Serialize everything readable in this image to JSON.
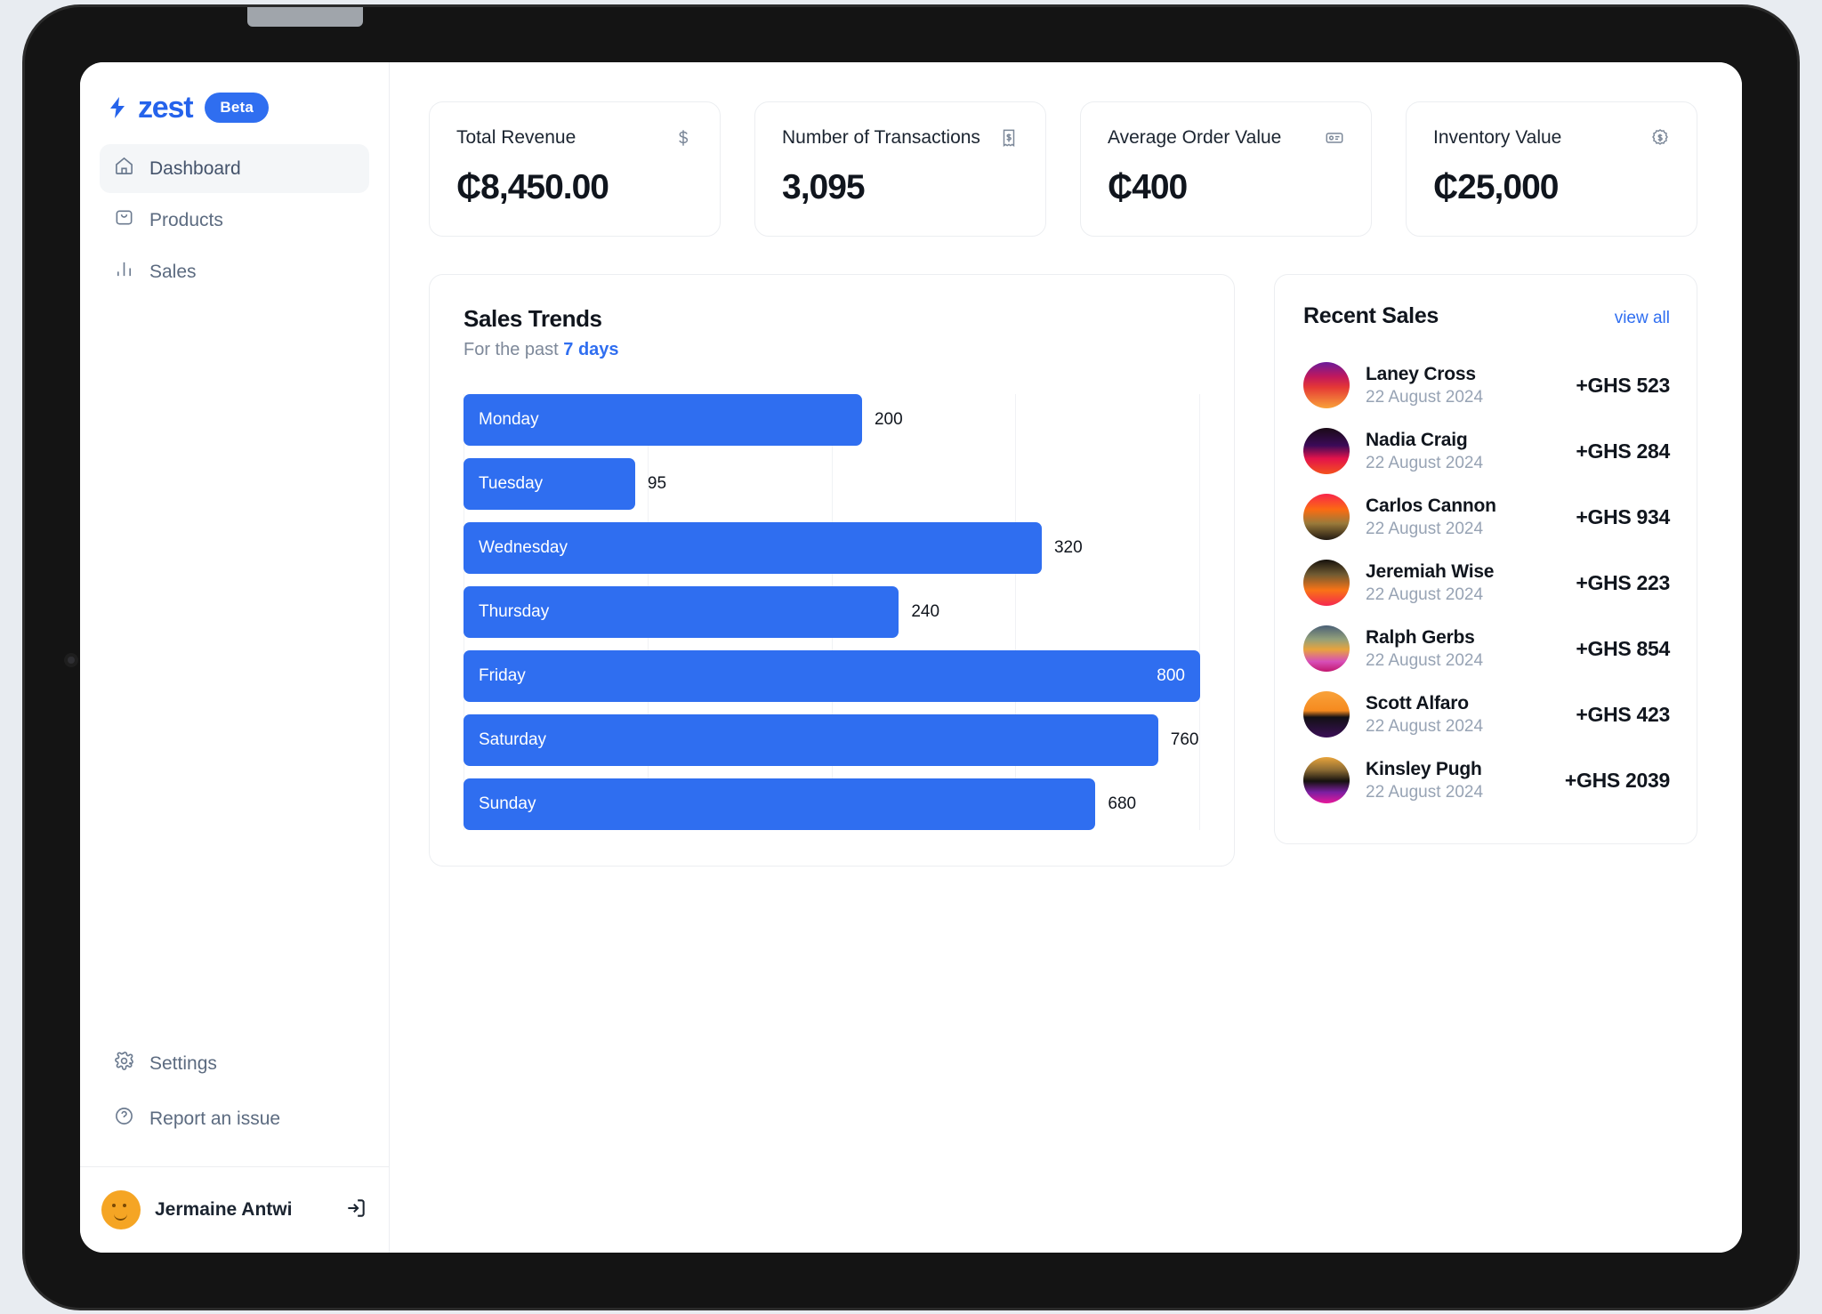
{
  "sidebar": {
    "logo_text": "zest",
    "badge": "Beta",
    "items": [
      {
        "label": "Dashboard",
        "icon": "home-icon",
        "active": true
      },
      {
        "label": "Products",
        "icon": "bag-icon",
        "active": false
      },
      {
        "label": "Sales",
        "icon": "bar-chart-icon",
        "active": false
      }
    ],
    "bottom_items": [
      {
        "label": "Settings",
        "icon": "gear-icon"
      },
      {
        "label": "Report an issue",
        "icon": "question-circle-icon"
      }
    ],
    "user": {
      "name": "Jermaine Antwi",
      "logout_icon": "logout-icon"
    }
  },
  "stats": [
    {
      "label": "Total Revenue",
      "value": "₵8,450.00",
      "icon": "dollar-icon"
    },
    {
      "label": "Number of Transactions",
      "value": "3,095",
      "icon": "receipt-icon"
    },
    {
      "label": "Average Order Value",
      "value": "₵400",
      "icon": "card-icon"
    },
    {
      "label": "Inventory Value",
      "value": "₵25,000",
      "icon": "badge-dollar-icon"
    }
  ],
  "chart_panel": {
    "title": "Sales Trends",
    "subtitle_prefix": "For the past ",
    "subtitle_highlight": "7 days"
  },
  "chart_data": {
    "type": "bar",
    "orientation": "horizontal",
    "title": "Sales Trends",
    "subtitle": "For the past 7 days",
    "categories": [
      "Monday",
      "Tuesday",
      "Wednesday",
      "Thursday",
      "Friday",
      "Saturday",
      "Sunday"
    ],
    "values": [
      200,
      95,
      320,
      240,
      800,
      760,
      680
    ],
    "bar_fractions": [
      0.541,
      0.233,
      0.785,
      0.591,
      1.0,
      0.943,
      0.858
    ],
    "value_label_inside": [
      false,
      false,
      false,
      false,
      true,
      false,
      false
    ],
    "xlabel": "",
    "ylabel": "",
    "grid": true,
    "gridline_count": 5,
    "bar_color": "#2f6ef0"
  },
  "recent": {
    "title": "Recent Sales",
    "view_all": "view all",
    "rows": [
      {
        "name": "Laney Cross",
        "date": "22 August 2024",
        "amount": "+GHS 523",
        "avatar": "linear-gradient(180deg,#6a1b9a 0%,#c2185b 32%,#e53935 55%,#f9a23a 100%)"
      },
      {
        "name": "Nadia Craig",
        "date": "22 August 2024",
        "amount": "+GHS 284",
        "avatar": "linear-gradient(180deg,#1a0a16 0%,#3b0a58 38%,#e3124b 66%,#f4521d 100%)"
      },
      {
        "name": "Carlos Cannon",
        "date": "22 August 2024",
        "amount": "+GHS 934",
        "avatar": "linear-gradient(180deg,#f8254a 0%,#fb6b12 34%,#9a7a3a 64%,#221a12 100%)"
      },
      {
        "name": "Jeremiah Wise",
        "date": "22 August 2024",
        "amount": "+GHS 223",
        "avatar": "linear-gradient(180deg,#15110c 0%,#6f5a32 32%,#f97316 66%,#f5284f 100%)"
      },
      {
        "name": "Ralph Gerbs",
        "date": "22 August 2024",
        "amount": "+GHS 854",
        "avatar": "linear-gradient(180deg,#4a6076 0%,#93a07a 30%,#e8a33d 52%,#d74fb8 78%,#c2186f 100%)"
      },
      {
        "name": "Scott Alfaro",
        "date": "22 August 2024",
        "amount": "+GHS 423",
        "avatar": "linear-gradient(180deg,#f9a23a 0%,#f58a1f 42%,#121015 56%,#3b0f57 100%)"
      },
      {
        "name": "Kinsley Pugh",
        "date": "22 August 2024",
        "amount": "+GHS 2039",
        "avatar": "linear-gradient(180deg,#e8a43c 0%,#8a6a33 28%,#15110e 52%,#7b1fa2 76%,#e8189a 100%)"
      }
    ]
  },
  "colors": {
    "accent": "#2f6ef0",
    "text": "#10151d",
    "muted": "#97a3b4",
    "card_border": "#eceef1"
  }
}
